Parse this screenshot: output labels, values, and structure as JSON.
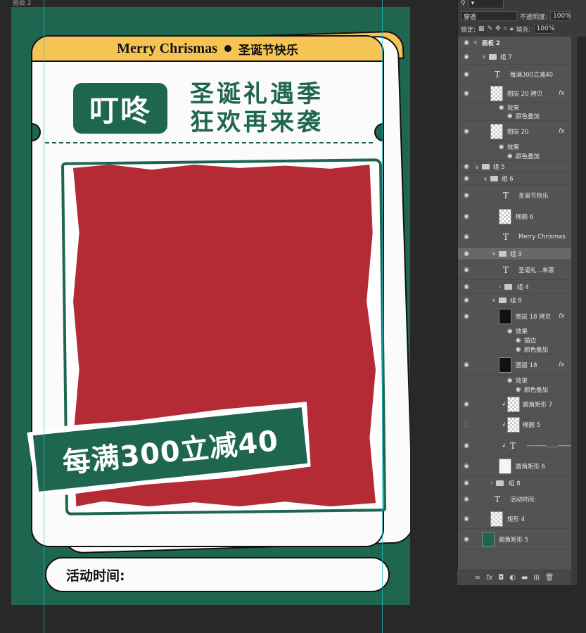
{
  "document": {
    "tab_label": "画板 2"
  },
  "poster": {
    "merry_en": "Merry Chrismas",
    "merry_cn": "圣诞节快乐",
    "badge": "叮咚",
    "headline_line1": "圣诞礼遇季",
    "headline_line2": "狂欢再来袭",
    "promo": "每满300立减40",
    "time_label": "活动时间:",
    "colors": {
      "green": "#1f6651",
      "red": "#b42b36",
      "yellow": "#f6c454",
      "white": "#fbfbfb"
    }
  },
  "options": {
    "blend_mode": "穿透",
    "opacity_label": "不透明度:",
    "opacity_value": "100%",
    "lock_label": "锁定:",
    "fill_label": "填充:",
    "fill_value": "100%"
  },
  "layers": {
    "artboard": "画板 2",
    "items": [
      {
        "name": "组 7",
        "kind": "group"
      },
      {
        "name": "每满300立减40",
        "kind": "text"
      },
      {
        "name": "图层 20 拷贝",
        "kind": "pixel",
        "fx": "fx"
      },
      {
        "name": "效果",
        "kind": "effect"
      },
      {
        "name": "颜色叠加",
        "kind": "effect"
      },
      {
        "name": "图层 20",
        "kind": "pixel",
        "fx": "fx"
      },
      {
        "name": "效果",
        "kind": "effect"
      },
      {
        "name": "颜色叠加",
        "kind": "effect"
      },
      {
        "name": "组 5",
        "kind": "group"
      },
      {
        "name": "组 6",
        "kind": "group"
      },
      {
        "name": "圣诞节快乐",
        "kind": "text"
      },
      {
        "name": "椭圆 6",
        "kind": "shape"
      },
      {
        "name": "Merry Chrismas",
        "kind": "text"
      },
      {
        "name": "组 3",
        "kind": "group"
      },
      {
        "name": "圣诞礼...来袭",
        "kind": "text"
      },
      {
        "name": "组 4",
        "kind": "group"
      },
      {
        "name": "组 8",
        "kind": "group"
      },
      {
        "name": "图层 18 拷贝",
        "kind": "pixel",
        "fx": "fx"
      },
      {
        "name": "效果",
        "kind": "effect"
      },
      {
        "name": "描边",
        "kind": "effect"
      },
      {
        "name": "颜色叠加",
        "kind": "effect"
      },
      {
        "name": "图层 18",
        "kind": "pixel",
        "fx": "fx"
      },
      {
        "name": "效果",
        "kind": "effect"
      },
      {
        "name": "颜色叠加",
        "kind": "effect"
      },
      {
        "name": "圆角矩形 7",
        "kind": "shape"
      },
      {
        "name": "椭圆 5",
        "kind": "shape"
      },
      {
        "name": "---------......--------",
        "kind": "text"
      },
      {
        "name": "圆角矩形 6",
        "kind": "shape"
      },
      {
        "name": "组 8",
        "kind": "group"
      },
      {
        "name": "活动时间:",
        "kind": "text"
      },
      {
        "name": "矩形 4",
        "kind": "shape"
      },
      {
        "name": "圆角矩形 5",
        "kind": "shape"
      }
    ]
  },
  "icons": [
    "eye-icon",
    "folder-icon",
    "text-layer-icon",
    "fx-icon",
    "link-icon",
    "mask-icon",
    "adjustment-icon",
    "new-group-icon",
    "new-layer-icon",
    "trash-icon"
  ]
}
